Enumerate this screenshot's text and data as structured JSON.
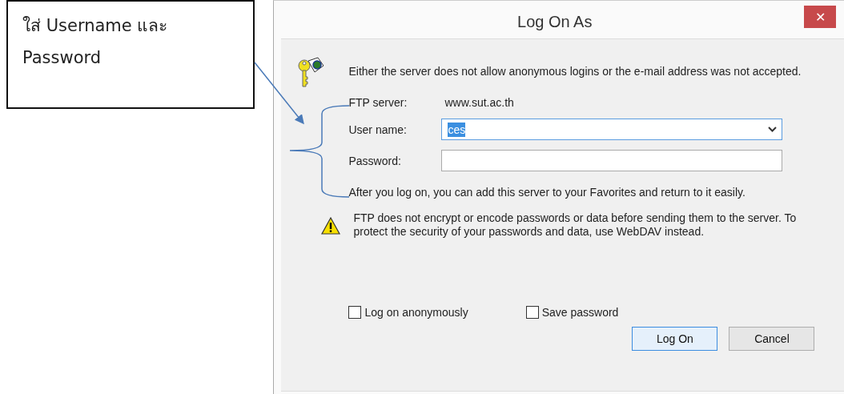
{
  "callout": {
    "text": "ใส่ Username และ Password"
  },
  "window": {
    "title": "Log On As",
    "close": "✕"
  },
  "message": "Either the server does not allow anonymous logins or the e-mail address was not accepted.",
  "form": {
    "server_label": "FTP server:",
    "server_value": "www.sut.ac.th",
    "username_label": "User name:",
    "username_value": "ces",
    "username_selected": true,
    "password_label": "Password:"
  },
  "note": "After you log on, you can add this server to your Favorites and return to it easily.",
  "warning": "FTP does not encrypt or encode passwords or data before sending them to the server.  To protect the security of your passwords and data, use WebDAV instead.",
  "checkboxes": [
    {
      "label": "Log on anonymously",
      "checked": false
    },
    {
      "label": "Save password",
      "checked": false
    }
  ],
  "buttons": [
    {
      "label": "Log On",
      "default": true
    },
    {
      "label": "Cancel",
      "default": false
    }
  ]
}
